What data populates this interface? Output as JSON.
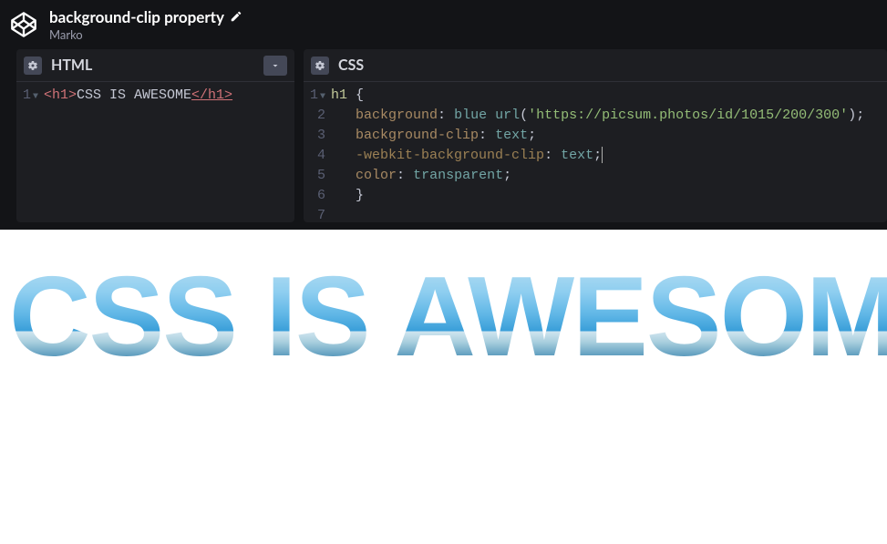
{
  "header": {
    "title": "background-clip property",
    "author": "Marko"
  },
  "panels": {
    "html": {
      "title": "HTML"
    },
    "css": {
      "title": "CSS"
    }
  },
  "code": {
    "html": {
      "gutter": [
        "1"
      ],
      "l1": {
        "open": "<h1>",
        "text": "CSS IS AWESOME",
        "close": "</h1>"
      }
    },
    "css": {
      "gutter": [
        "1",
        "2",
        "3",
        "4",
        "5",
        "6",
        "7"
      ],
      "l1": {
        "sel": "h1",
        "brace": " {"
      },
      "l2": {
        "indent": "   ",
        "prop": "background",
        "colon": ":",
        "sp": " ",
        "v1": "blue",
        "sp2": " ",
        "fn": "url",
        "paren1": "(",
        "str": "'https://picsum.photos/id/1015/200/300'",
        "paren2": ")",
        "semi": ";"
      },
      "l3": {
        "indent": "   ",
        "prop": "background-clip",
        "colon": ":",
        "sp": " ",
        "v": "text",
        "semi": ";"
      },
      "l4": {
        "indent": "   ",
        "prop": "-webkit-background-clip",
        "colon": ":",
        "sp": " ",
        "v": "text",
        "semi": ";"
      },
      "l5": {
        "indent": "   ",
        "prop": "color",
        "colon": ":",
        "sp": " ",
        "v": "transparent",
        "semi": ";"
      },
      "l6": {
        "indent": "   ",
        "brace": "}"
      }
    }
  },
  "preview": {
    "text": "CSS IS AWESOME"
  }
}
